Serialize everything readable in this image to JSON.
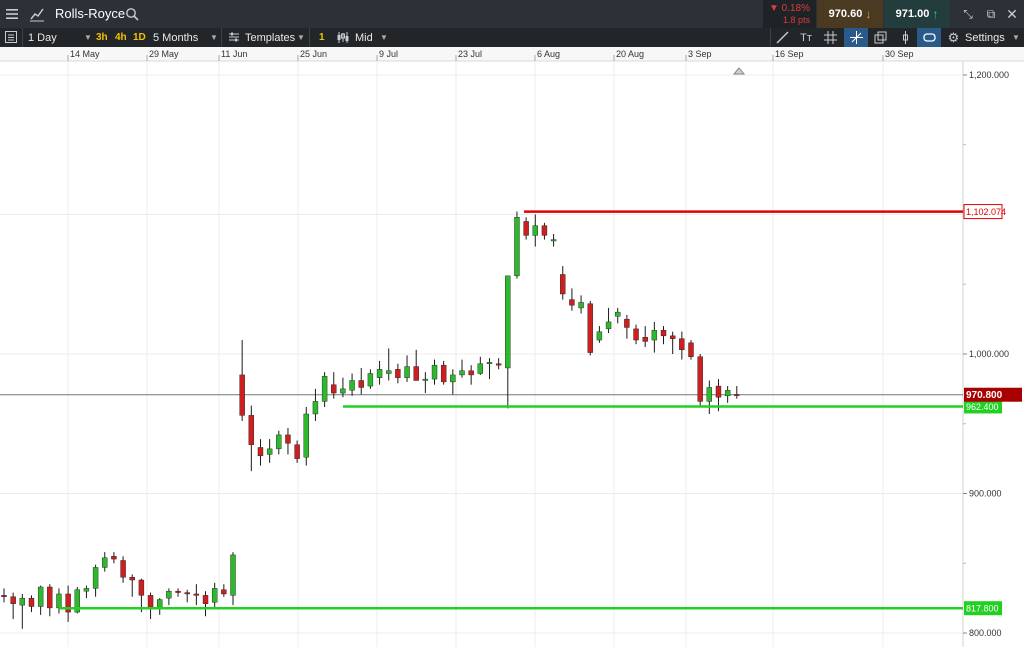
{
  "header": {
    "instrument": "Rolls-Royce",
    "change_pct": "▼ 0.18%",
    "change_pts": "1.8 pts",
    "sell_price": "970.60",
    "buy_price": "971.00"
  },
  "toolbar": {
    "interval": "1 Day",
    "quick_intervals": [
      "3h",
      "4h",
      "1D"
    ],
    "range": "5 Months",
    "templates": "Templates",
    "count": "1",
    "price_type": "Mid",
    "settings": "Settings"
  },
  "colors": {
    "up": "#2eb82e",
    "down": "#cc1f1f",
    "resistance": "#e00000",
    "support": "#22d022",
    "current": "#a80000"
  },
  "chart_data": {
    "type": "candlestick",
    "x_axis_labels": [
      "14 May",
      "29 May",
      "11 Jun",
      "25 Jun",
      "9 Jul",
      "23 Jul",
      "6 Aug",
      "20 Aug",
      "3 Sep",
      "16 Sep",
      "30 Sep"
    ],
    "y_axis_labels": [
      "1,200.000",
      "1,000.000",
      "900.000",
      "800.000"
    ],
    "y_range": [
      795,
      1210
    ],
    "candles": [
      [
        827,
        832,
        822,
        826
      ],
      [
        826,
        829,
        810,
        821
      ],
      [
        820,
        828,
        803,
        825
      ],
      [
        825,
        827,
        815,
        819
      ],
      [
        819,
        834,
        813,
        833
      ],
      [
        833,
        835,
        812,
        818
      ],
      [
        818,
        832,
        814,
        828
      ],
      [
        828,
        834,
        808,
        815
      ],
      [
        815,
        833,
        814,
        831
      ],
      [
        830,
        834,
        825,
        832
      ],
      [
        832,
        849,
        826,
        847
      ],
      [
        847,
        858,
        844,
        854
      ],
      [
        855,
        858,
        850,
        853
      ],
      [
        852,
        855,
        836,
        840
      ],
      [
        840,
        842,
        826,
        838
      ],
      [
        838,
        839,
        815,
        827
      ],
      [
        827,
        829,
        810,
        818
      ],
      [
        818,
        825,
        813,
        824
      ],
      [
        825,
        832,
        820,
        830
      ],
      [
        830,
        832,
        826,
        829
      ],
      [
        829,
        831,
        822,
        828
      ],
      [
        828,
        835,
        820,
        827
      ],
      [
        827,
        830,
        812,
        821
      ],
      [
        822,
        836,
        818,
        832
      ],
      [
        831,
        835,
        826,
        828
      ],
      [
        827,
        858,
        820,
        856
      ],
      [
        985,
        1010,
        952,
        956
      ],
      [
        956,
        963,
        916,
        935
      ],
      [
        933,
        939,
        920,
        927
      ],
      [
        928,
        939,
        922,
        932
      ],
      [
        932,
        945,
        928,
        942
      ],
      [
        942,
        947,
        928,
        936
      ],
      [
        935,
        938,
        922,
        925
      ],
      [
        926,
        962,
        920,
        957
      ],
      [
        957,
        975,
        952,
        966
      ],
      [
        966,
        987,
        962,
        984
      ],
      [
        978,
        987,
        968,
        972
      ],
      [
        972,
        983,
        969,
        975
      ],
      [
        974,
        986,
        970,
        981
      ],
      [
        981,
        990,
        971,
        976
      ],
      [
        977,
        989,
        975,
        986
      ],
      [
        983,
        995,
        978,
        989
      ],
      [
        986,
        1004,
        981,
        988
      ],
      [
        989,
        993,
        979,
        983
      ],
      [
        983,
        999,
        980,
        991
      ],
      [
        991,
        1003,
        984,
        981
      ],
      [
        981,
        987,
        972,
        982
      ],
      [
        982,
        996,
        978,
        992
      ],
      [
        992,
        995,
        978,
        980
      ],
      [
        980,
        989,
        971,
        985
      ],
      [
        985,
        996,
        983,
        988
      ],
      [
        988,
        992,
        978,
        985
      ],
      [
        986,
        998,
        985,
        993
      ],
      [
        993,
        997,
        982,
        994
      ],
      [
        993,
        997,
        989,
        992
      ],
      [
        990,
        1002,
        961,
        1056
      ],
      [
        1056,
        1102.07,
        1054,
        1098
      ],
      [
        1095,
        1098,
        1082,
        1085
      ],
      [
        1085,
        1100,
        1077,
        1092
      ],
      [
        1092,
        1094,
        1082,
        1085
      ],
      [
        1081,
        1086,
        1077,
        1082
      ],
      [
        1057,
        1063,
        1039,
        1043
      ],
      [
        1039,
        1047,
        1031,
        1035
      ],
      [
        1033,
        1042,
        1029,
        1037
      ],
      [
        1036,
        1038,
        999,
        1001
      ],
      [
        1010,
        1020,
        1008,
        1016
      ],
      [
        1018,
        1033,
        1015,
        1023
      ],
      [
        1027,
        1033,
        1022,
        1030
      ],
      [
        1025,
        1028,
        1011,
        1019
      ],
      [
        1018,
        1021,
        1007,
        1010
      ],
      [
        1012,
        1020,
        1005,
        1009
      ],
      [
        1010,
        1023,
        1001,
        1017
      ],
      [
        1017,
        1020,
        1007,
        1013
      ],
      [
        1013,
        1016,
        1000,
        1011
      ],
      [
        1011,
        1016,
        996,
        1003
      ],
      [
        1008,
        1010,
        996,
        998
      ],
      [
        998,
        1000,
        962,
        966
      ],
      [
        966,
        981,
        957,
        976
      ],
      [
        977,
        982,
        959,
        969
      ],
      [
        970,
        977,
        965,
        974
      ],
      [
        971,
        977,
        968,
        970.8
      ]
    ],
    "horizontal_lines": [
      {
        "label": "1,102.074",
        "value": 1102.074,
        "kind": "resistance"
      },
      {
        "label": "962.400",
        "value": 962.4,
        "kind": "support"
      },
      {
        "label": "817.800",
        "value": 817.8,
        "kind": "support"
      },
      {
        "label": "970.800",
        "value": 970.8,
        "kind": "current"
      }
    ]
  }
}
